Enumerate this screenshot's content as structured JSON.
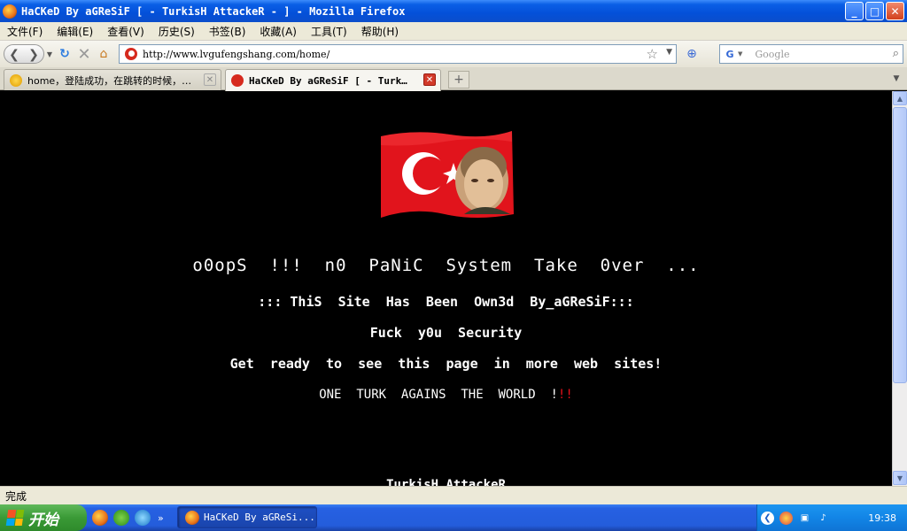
{
  "window": {
    "title": "HaCKeD By aGReSiF [ - TurkisH AttackeR - ] - Mozilla Firefox",
    "controls": {
      "minimize": "_",
      "maximize": "□",
      "close": "✕"
    }
  },
  "menubar": {
    "items": [
      "文件(F)",
      "编辑(E)",
      "查看(V)",
      "历史(S)",
      "书签(B)",
      "收藏(A)",
      "工具(T)",
      "帮助(H)"
    ]
  },
  "navbar": {
    "url": "http://www.lvgufengshang.com/home/",
    "search_placeholder": "Google",
    "search_engine_icon": "google-icon"
  },
  "tabs": [
    {
      "label": "home，登陆成功，在跳转的时候，…",
      "active": false
    },
    {
      "label": "HaCKeD By aGReSiF [ - Turk…",
      "active": true
    }
  ],
  "page": {
    "line1": "o0opS  !!!  n0  PaNiC  System  Take  0ver  ...",
    "line2": "::: ThiS  Site  Has  Been  Own3d  By_aGReSiF:::",
    "line3": "Fuck  y0u  Security",
    "line4": "Get  ready  to  see  this  page  in  more  web  sites!",
    "line5_white": "ONE  TURK  AGAINS  THE  WORLD  !",
    "line5_red": "!!",
    "line6": "TurkisH AttackeR",
    "colors": {
      "background": "#000000",
      "text": "#ffffff",
      "accent": "#e8101a"
    }
  },
  "statusbar": {
    "text": "完成"
  },
  "taskbar": {
    "start_label": "开始",
    "task_label": "HaCKeD By aGReSi...",
    "tray_lang_p": "P",
    "tray_lang_q": "?",
    "clock": "19:38"
  }
}
